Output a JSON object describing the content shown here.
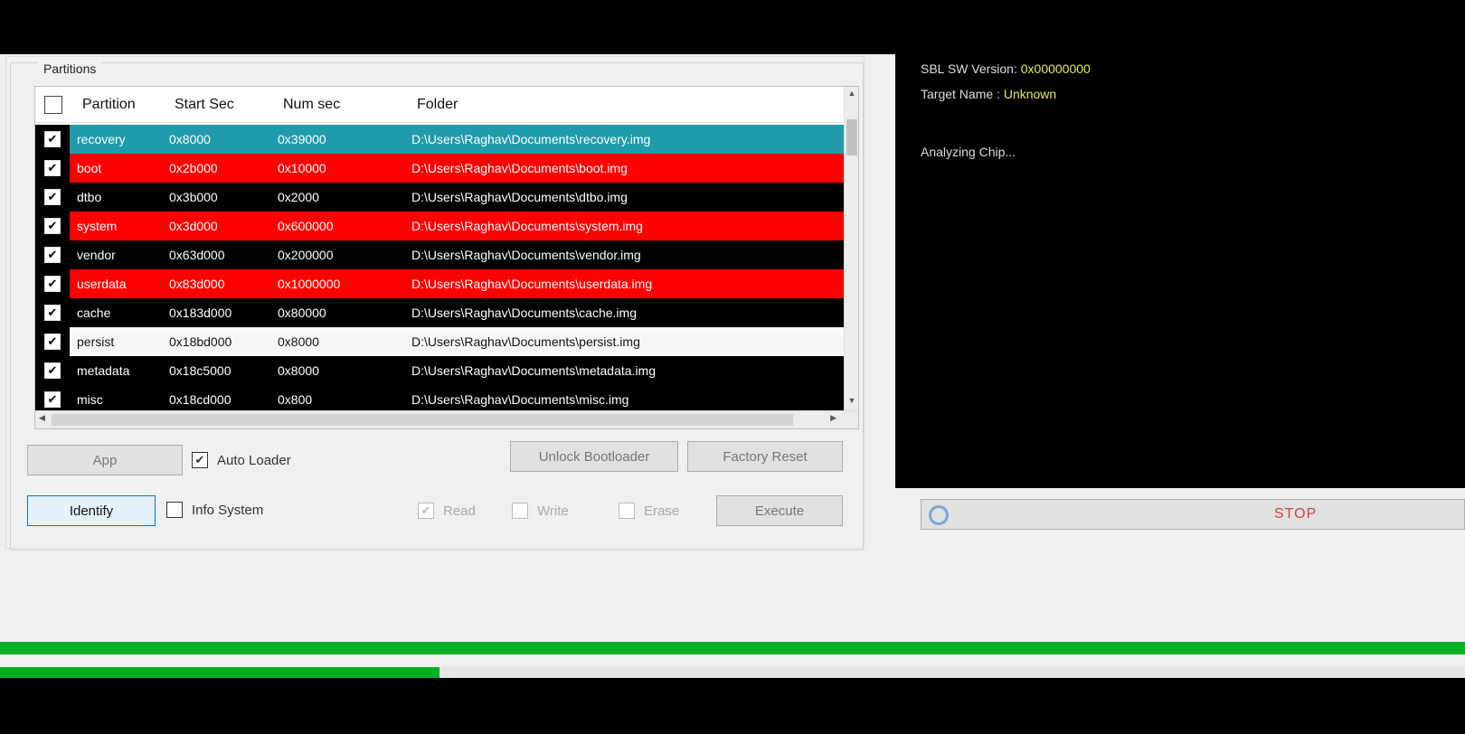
{
  "colors": {
    "row_selected": "#1f9bab",
    "row_red": "#ff0000",
    "row_black": "#000000",
    "row_white": "#f7f7f7",
    "progress": "#06b025",
    "stop_text": "#d04040"
  },
  "group": {
    "title": "Partitions"
  },
  "table": {
    "columns": [
      "Partition",
      "Start Sec",
      "Num sec",
      "Folder"
    ],
    "rows": [
      {
        "name": "recovery",
        "start": "0x8000",
        "num": "0x39000",
        "folder": "D:\\Users\\Raghav\\Documents\\recovery.img",
        "style": "selected",
        "checked": true
      },
      {
        "name": "boot",
        "start": "0x2b000",
        "num": "0x10000",
        "folder": "D:\\Users\\Raghav\\Documents\\boot.img",
        "style": "red",
        "checked": true
      },
      {
        "name": "dtbo",
        "start": "0x3b000",
        "num": "0x2000",
        "folder": "D:\\Users\\Raghav\\Documents\\dtbo.img",
        "style": "black",
        "checked": true
      },
      {
        "name": "system",
        "start": "0x3d000",
        "num": "0x600000",
        "folder": "D:\\Users\\Raghav\\Documents\\system.img",
        "style": "red",
        "checked": true
      },
      {
        "name": "vendor",
        "start": "0x63d000",
        "num": "0x200000",
        "folder": "D:\\Users\\Raghav\\Documents\\vendor.img",
        "style": "black",
        "checked": true
      },
      {
        "name": "userdata",
        "start": "0x83d000",
        "num": "0x1000000",
        "folder": "D:\\Users\\Raghav\\Documents\\userdata.img",
        "style": "red",
        "checked": true
      },
      {
        "name": "cache",
        "start": "0x183d000",
        "num": "0x80000",
        "folder": "D:\\Users\\Raghav\\Documents\\cache.img",
        "style": "black",
        "checked": true
      },
      {
        "name": "persist",
        "start": "0x18bd000",
        "num": "0x8000",
        "folder": "D:\\Users\\Raghav\\Documents\\persist.img",
        "style": "white",
        "checked": true
      },
      {
        "name": "metadata",
        "start": "0x18c5000",
        "num": "0x8000",
        "folder": "D:\\Users\\Raghav\\Documents\\metadata.img",
        "style": "black",
        "checked": true
      },
      {
        "name": "misc",
        "start": "0x18cd000",
        "num": "0x800",
        "folder": "D:\\Users\\Raghav\\Documents\\misc.img",
        "style": "black",
        "checked": true
      }
    ]
  },
  "controls": {
    "app_label": "App",
    "auto_loader_label": "Auto Loader",
    "identify_label": "Identify",
    "info_system_label": "Info System",
    "read_label": "Read",
    "write_label": "Write",
    "erase_label": "Erase",
    "unlock_label": "Unlock",
    "unlock_bootloader_label": "Unlock Bootloader",
    "factory_reset_label": "Factory Reset",
    "execute_label": "Execute"
  },
  "log": {
    "line1_prefix": "SBL SW Version: ",
    "line1_value": "0x00000000",
    "line2_prefix": "Target Name : ",
    "line2_value": "Unknown",
    "line3": "Analyzing Chip..."
  },
  "stop": {
    "label": "STOP"
  },
  "progress": {
    "upper_fraction": 1.0,
    "lower_fraction": 0.3
  }
}
